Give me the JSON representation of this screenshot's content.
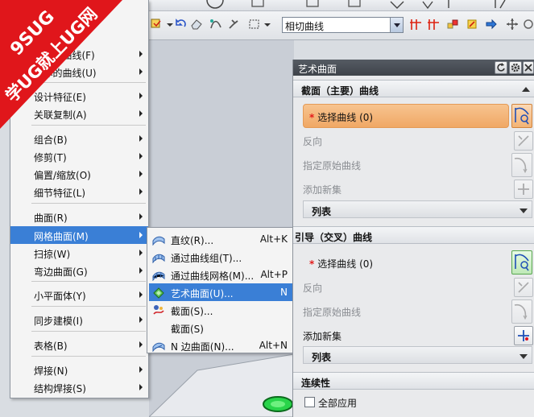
{
  "banner": {
    "logo_text": "9SUG",
    "slogan": "学UG就上UG网"
  },
  "toolbar": {
    "curve_filter_value": "相切曲线"
  },
  "main_menu": {
    "items": [
      {
        "label": "...集的曲线(F)",
        "has_submenu": true
      },
      {
        "label": "...体的曲线(U)",
        "has_submenu": true
      },
      {
        "label": "设计特征(E)",
        "has_submenu": true
      },
      {
        "label": "关联复制(A)",
        "has_submenu": true
      },
      {
        "label": "组合(B)",
        "has_submenu": true
      },
      {
        "label": "修剪(T)",
        "has_submenu": true
      },
      {
        "label": "偏置/缩放(O)",
        "has_submenu": true
      },
      {
        "label": "细节特征(L)",
        "has_submenu": true
      },
      {
        "label": "曲面(R)",
        "has_submenu": true
      },
      {
        "label": "网格曲面(M)",
        "has_submenu": true
      },
      {
        "label": "扫掠(W)",
        "has_submenu": true
      },
      {
        "label": "弯边曲面(G)",
        "has_submenu": true
      },
      {
        "label": "小平面体(Y)",
        "has_submenu": true
      },
      {
        "label": "同步建模(I)",
        "has_submenu": true
      },
      {
        "label": "表格(B)",
        "has_submenu": true
      },
      {
        "label": "焊接(N)",
        "has_submenu": true
      },
      {
        "label": "结构焊接(S)",
        "has_submenu": true
      }
    ]
  },
  "sub_menu": {
    "items": [
      {
        "label": "直纹(R)...",
        "shortcut": "Alt+K",
        "icon": "ruled-surface-icon"
      },
      {
        "label": "通过曲线组(T)...",
        "shortcut": "",
        "icon": "through-curves-icon"
      },
      {
        "label": "通过曲线网格(M)...",
        "shortcut": "Alt+P",
        "icon": "curve-mesh-icon"
      },
      {
        "label": "艺术曲面(U)...",
        "shortcut": "N",
        "icon": "studio-surface-icon"
      },
      {
        "label": "截面(S)...",
        "shortcut": "",
        "icon": "section-icon"
      },
      {
        "label": "截面(S)",
        "shortcut": "",
        "icon": ""
      },
      {
        "label": "N 边曲面(N)...",
        "shortcut": "Alt+N",
        "icon": "n-sided-surface-icon"
      }
    ]
  },
  "dialog": {
    "title": "艺术曲面",
    "section_primary": {
      "title": "截面（主要）曲线",
      "select_curve": "选择曲线 (0)",
      "reverse": "反向",
      "specify_origin": "指定原始曲线",
      "add_new": "添加新集",
      "list": "列表"
    },
    "section_guide": {
      "title": "引导（交叉）曲线",
      "select_curve": "选择曲线 (0)",
      "reverse": "反向",
      "specify_origin": "指定原始曲线",
      "add_new": "添加新集",
      "list": "列表"
    },
    "section_continuity": {
      "title": "连续性",
      "apply_all": "全部应用"
    }
  },
  "colors": {
    "menu_highlight": "#3a7fd6",
    "banner_red": "#e0161b",
    "select_highlight": "#f0a865"
  }
}
